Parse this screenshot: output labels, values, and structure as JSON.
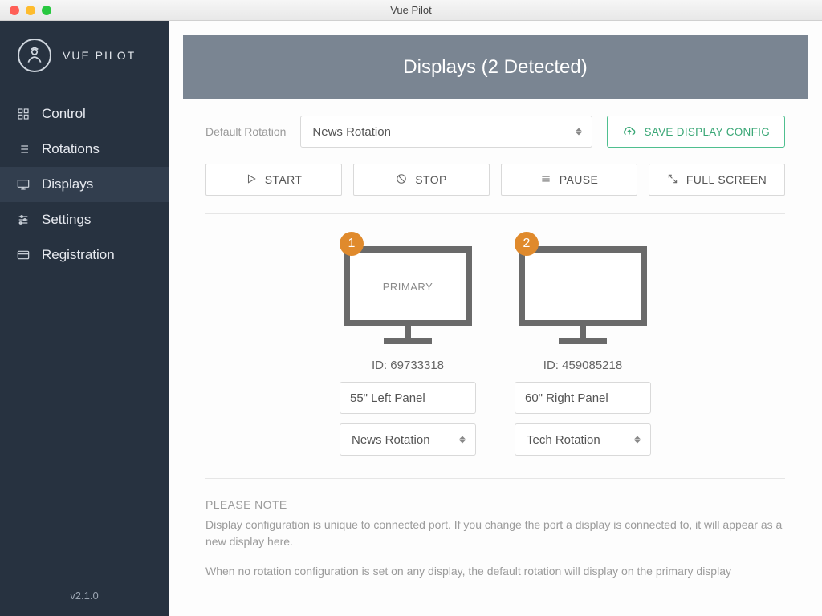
{
  "window": {
    "title": "Vue Pilot"
  },
  "brand": {
    "name": "VUE PILOT"
  },
  "sidebar": {
    "items": [
      {
        "label": "Control"
      },
      {
        "label": "Rotations"
      },
      {
        "label": "Displays"
      },
      {
        "label": "Settings"
      },
      {
        "label": "Registration"
      }
    ],
    "active_index": 2
  },
  "version": "v2.1.0",
  "header": {
    "title": "Displays (2 Detected)"
  },
  "default_rotation": {
    "label": "Default Rotation",
    "selected": "News Rotation"
  },
  "save_button": {
    "label": "SAVE DISPLAY CONFIG"
  },
  "actions": {
    "start": "START",
    "stop": "STOP",
    "pause": "PAUSE",
    "fullscreen": "FULL SCREEN"
  },
  "displays": [
    {
      "badge": "1",
      "primary_label": "PRIMARY",
      "id_label": "ID: 69733318",
      "name": "55\" Left Panel",
      "rotation": "News Rotation"
    },
    {
      "badge": "2",
      "primary_label": "",
      "id_label": "ID: 459085218",
      "name": "60\" Right Panel",
      "rotation": "Tech Rotation"
    }
  ],
  "note": {
    "title": "PLEASE NOTE",
    "p1": "Display configuration is unique to connected port. If you change the port a display is connected to, it will appear as a new display here.",
    "p2": "When no rotation configuration is set on any display, the default rotation will display on the primary display"
  }
}
